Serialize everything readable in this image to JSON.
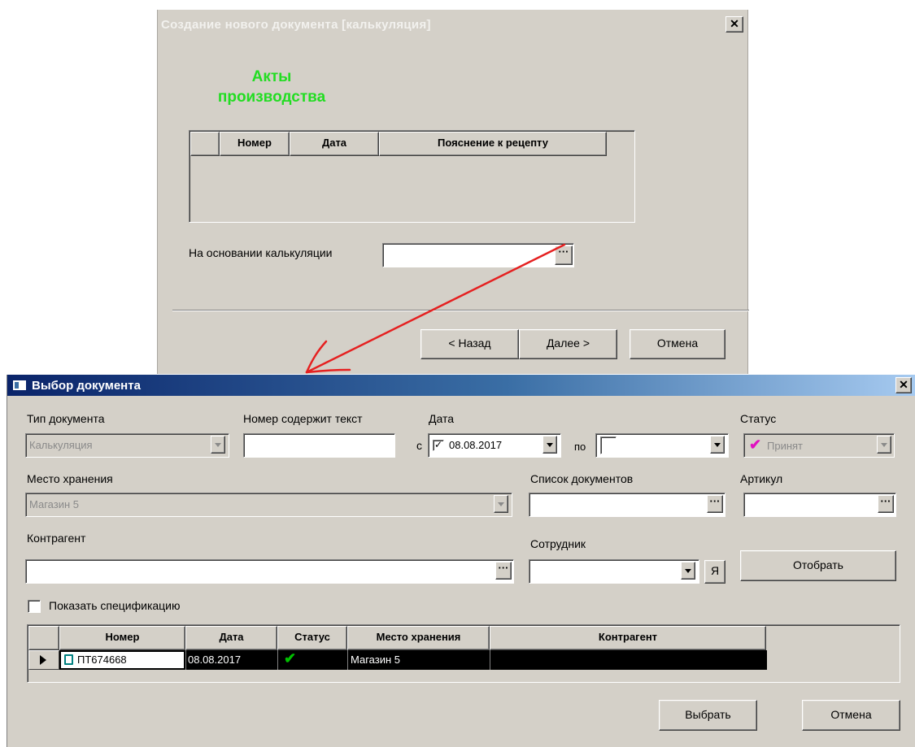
{
  "wizard": {
    "title": "Создание нового документа [калькуляция]",
    "section_line1": "Акты",
    "section_line2": "производства",
    "columns": [
      "Номер",
      "Дата",
      "Пояснение к рецепту"
    ],
    "basis_label": "На основании калькуляции",
    "basis_value": "",
    "back_label": "< Назад",
    "next_label": "Далее >",
    "cancel_label": "Отмена",
    "close_glyph": "✕"
  },
  "picker": {
    "title": "Выбор документа",
    "close_glyph": "✕",
    "doc_type_label": "Тип документа",
    "doc_type_value": "Калькуляция",
    "number_label": "Номер содержит текст",
    "number_value": "",
    "date_label": "Дата",
    "date_from_prefix": "с",
    "date_from_value": "08.08.2017",
    "date_from_checked": true,
    "date_to_prefix": "по",
    "date_to_value": "",
    "status_label": "Статус",
    "status_value": "Принят",
    "storage_label": "Место хранения",
    "storage_value": "Магазин 5",
    "doclist_label": "Список документов",
    "doclist_value": "",
    "article_label": "Артикул",
    "article_value": "",
    "counterparty_label": "Контрагент",
    "counterparty_value": "",
    "employee_label": "Сотрудник",
    "employee_value": "",
    "me_button": "Я",
    "select_button": "Отобрать",
    "show_spec_label": "Показать спецификацию",
    "columns": [
      "Номер",
      "Дата",
      "Статус",
      "Место хранения",
      "Контрагент"
    ],
    "rows": [
      {
        "number": "ПТ674668",
        "date": "08.08.2017",
        "status": "accepted",
        "storage": "Магазин 5",
        "counterparty": ""
      }
    ],
    "choose_button": "Выбрать",
    "cancel_button": "Отмена"
  },
  "colors": {
    "section_title": "#22dd22",
    "titlebar_start": "#0a246a",
    "titlebar_end": "#a6caf0",
    "annotation_arrow": "#e52020",
    "status_check": "#00c000",
    "status_mark": "#e010c0"
  }
}
